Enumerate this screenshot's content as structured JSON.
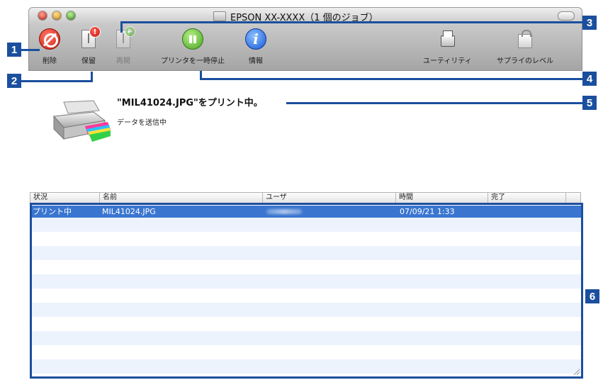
{
  "window": {
    "title": "EPSON XX-XXXX（1 個のジョブ）"
  },
  "toolbar": {
    "delete_label": "削除",
    "hold_label": "保留",
    "hold_badge": "!",
    "resume_label": "再開",
    "pause_printer_label": "プリンタを一時停止",
    "info_label": "情報",
    "info_glyph": "i",
    "utility_label": "ユーティリティ",
    "supply_levels_label": "サプライのレベル"
  },
  "status": {
    "main": "\"MIL41024.JPG\"をプリント中。",
    "sub": "データを送信中"
  },
  "table": {
    "columns": [
      "状況",
      "名前",
      "ユーザ",
      "時間",
      "完了"
    ],
    "rows": [
      {
        "status": "プリント中",
        "name": "MIL41024.JPG",
        "user": "",
        "time": "07/09/21 1:33",
        "done": ""
      }
    ]
  },
  "callouts": [
    "1",
    "2",
    "3",
    "4",
    "5",
    "6"
  ],
  "colors": {
    "callout": "#1b4f9e",
    "selection": "#3a76d0",
    "stripe": "#edf3fd"
  }
}
